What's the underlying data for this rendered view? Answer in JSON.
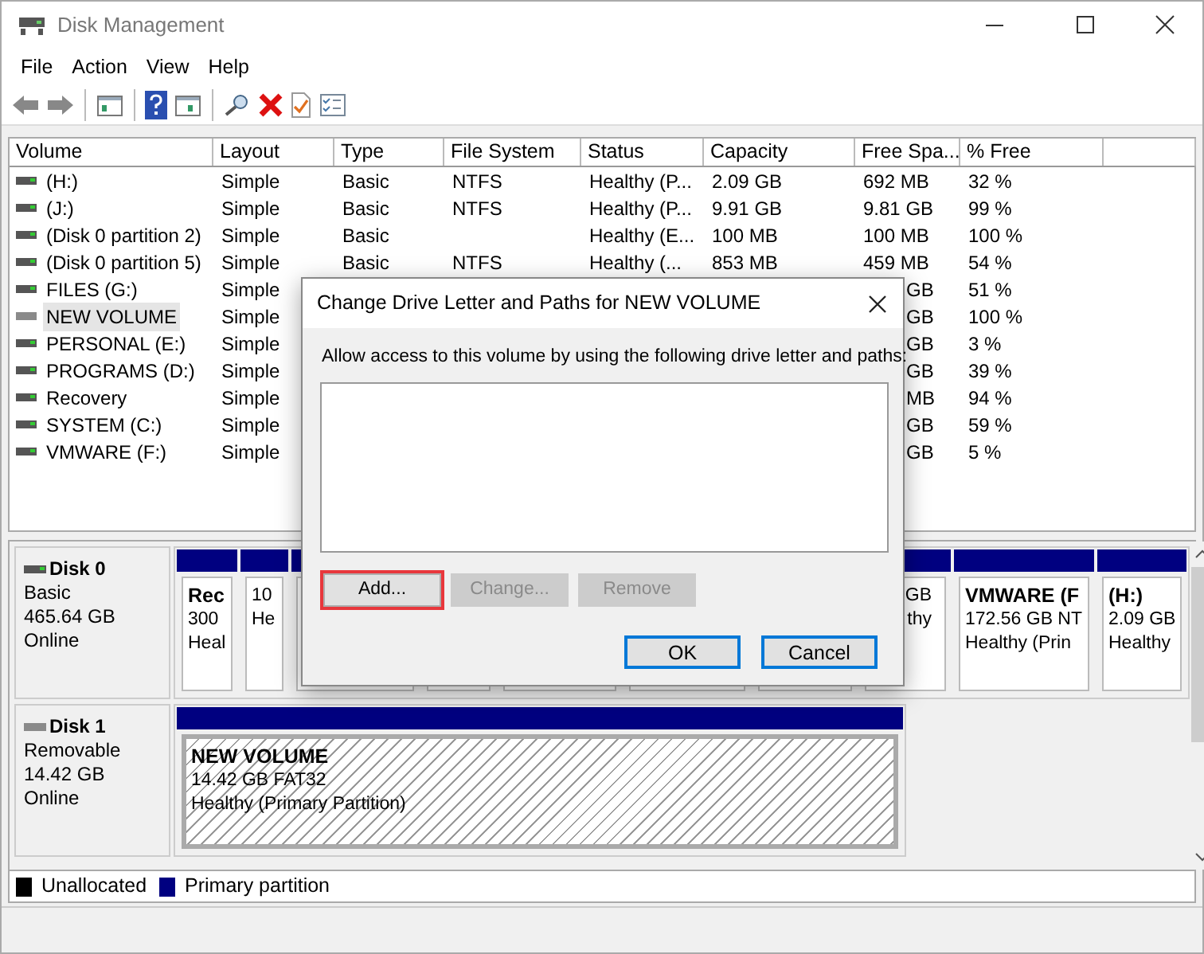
{
  "window": {
    "title": "Disk Management"
  },
  "menu": [
    "File",
    "Action",
    "View",
    "Help"
  ],
  "table": {
    "columns": [
      "Volume",
      "Layout",
      "Type",
      "File System",
      "Status",
      "Capacity",
      "Free Spa...",
      "% Free"
    ],
    "rows": [
      {
        "volume": "(H:)",
        "kind": "fixed",
        "selected": false,
        "layout": "Simple",
        "type": "Basic",
        "file_system": "NTFS",
        "status": "Healthy (P...",
        "capacity": "2.09 GB",
        "free_space": "692 MB",
        "percent_free": "32 %"
      },
      {
        "volume": "(J:)",
        "kind": "fixed",
        "selected": false,
        "layout": "Simple",
        "type": "Basic",
        "file_system": "NTFS",
        "status": "Healthy (P...",
        "capacity": "9.91 GB",
        "free_space": "9.81 GB",
        "percent_free": "99 %"
      },
      {
        "volume": "(Disk 0 partition 2)",
        "kind": "fixed",
        "selected": false,
        "layout": "Simple",
        "type": "Basic",
        "status": "Healthy (E...",
        "capacity": "100 MB",
        "free_space": "100 MB",
        "percent_free": "100 %"
      },
      {
        "volume": "(Disk 0 partition 5)",
        "kind": "fixed",
        "selected": false,
        "layout": "Simple",
        "type": "Basic",
        "file_system": "NTFS",
        "status": "Healthy (...",
        "capacity": "853 MB",
        "free_space": "459 MB",
        "percent_free": "54 %"
      },
      {
        "volume": "FILES (G:)",
        "kind": "fixed",
        "selected": false,
        "layout": "Simple",
        "free_space": "GB",
        "percent_free": "51 %"
      },
      {
        "volume": "NEW VOLUME",
        "kind": "removable",
        "selected": true,
        "layout": "Simple",
        "free_space": "GB",
        "percent_free": "100 %"
      },
      {
        "volume": "PERSONAL (E:)",
        "kind": "fixed",
        "selected": false,
        "layout": "Simple",
        "free_space": "GB",
        "percent_free": "3 %"
      },
      {
        "volume": "PROGRAMS (D:)",
        "kind": "fixed",
        "selected": false,
        "layout": "Simple",
        "free_space": "GB",
        "percent_free": "39 %"
      },
      {
        "volume": "Recovery",
        "kind": "fixed",
        "selected": false,
        "layout": "Simple",
        "free_space": "MB",
        "percent_free": "94 %"
      },
      {
        "volume": "SYSTEM (C:)",
        "kind": "fixed",
        "selected": false,
        "layout": "Simple",
        "free_space": "GB",
        "percent_free": "59 %"
      },
      {
        "volume": "VMWARE (F:)",
        "kind": "fixed",
        "selected": false,
        "layout": "Simple",
        "free_space": "GB",
        "percent_free": "5 %"
      }
    ]
  },
  "disks": [
    {
      "name": "Disk 0",
      "kind": "fixed",
      "details": [
        "Basic",
        "465.64 GB",
        "Online"
      ],
      "partitions": [
        {
          "kind": "primary",
          "selected": false,
          "name": "Rec",
          "details": [
            "300",
            "Heal"
          ]
        },
        {
          "kind": "primary",
          "selected": false,
          "details": [
            "10",
            "He"
          ]
        },
        {
          "kind": "primary",
          "selected": false
        },
        {
          "kind": "primary",
          "selected": false
        },
        {
          "kind": "primary",
          "selected": false
        },
        {
          "kind": "primary",
          "selected": false
        },
        {
          "kind": "primary",
          "selected": false
        },
        {
          "kind": "primary",
          "selected": false,
          "details": [
            "GB",
            "thy"
          ]
        },
        {
          "kind": "primary",
          "selected": false,
          "name": "VMWARE (F",
          "details": [
            "172.56 GB NT",
            "Healthy (Prin"
          ]
        },
        {
          "kind": "primary",
          "selected": false,
          "name": "(H:)",
          "details": [
            "2.09 GB",
            "Healthy"
          ]
        }
      ]
    },
    {
      "name": "Disk 1",
      "kind": "removable",
      "details": [
        "Removable",
        "14.42 GB",
        "Online"
      ],
      "partitions": [
        {
          "kind": "primary",
          "selected": true,
          "name": "NEW VOLUME",
          "details": [
            "14.42 GB FAT32",
            "Healthy (Primary Partition)"
          ]
        }
      ]
    }
  ],
  "legend": [
    {
      "label": "Unallocated",
      "color": "#000000"
    },
    {
      "label": "Primary partition",
      "color": "#000080"
    }
  ],
  "dialog": {
    "title": "Change Drive Letter and Paths for NEW VOLUME",
    "prompt": "Allow access to this volume by using the following drive letter and paths:",
    "actions": [
      {
        "label": "Add...",
        "disabled": false,
        "highlighted": true
      },
      {
        "label": "Change...",
        "disabled": true,
        "highlighted": false
      },
      {
        "label": "Remove",
        "disabled": true,
        "highlighted": false
      }
    ],
    "buttons": [
      "OK",
      "Cancel"
    ]
  }
}
